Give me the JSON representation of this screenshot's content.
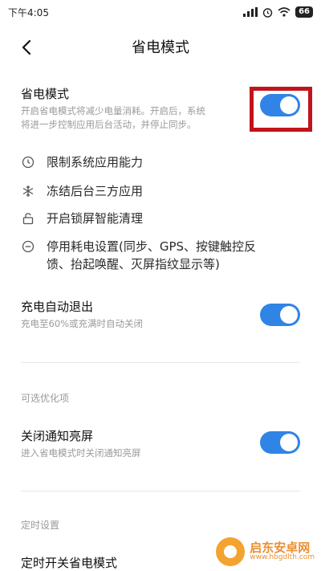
{
  "status_bar": {
    "time": "下午4:05",
    "signal": "..ll",
    "alarm": "⏰",
    "wifi": "wifi",
    "battery": "66"
  },
  "header": {
    "title": "省电模式"
  },
  "power_saving": {
    "title": "省电模式",
    "desc_line1": "开启省电模式将减少电量消耗。开启后，系统",
    "desc_line2": "将进一步控制应用后台活动，并停止同步。",
    "enabled": true
  },
  "features": [
    {
      "icon": "clock-icon",
      "text": "限制系统应用能力"
    },
    {
      "icon": "snowflake-icon",
      "text": "冻结后台三方应用"
    },
    {
      "icon": "lock-icon",
      "text": "开启锁屏智能清理"
    },
    {
      "icon": "minus-circle-icon",
      "text_line1": "停用耗电设置(同步、GPS、按键触控反",
      "text_line2": "馈、抬起唤醒、灭屏指纹显示等)"
    }
  ],
  "auto_exit": {
    "title": "充电自动退出",
    "desc": "充电至60%或充满时自动关闭",
    "enabled": true
  },
  "optional_section": {
    "label": "可选优化项"
  },
  "notify_screen": {
    "title": "关闭通知亮屏",
    "desc": "进入省电模式时关闭通知亮屏",
    "enabled": true
  },
  "schedule_section": {
    "label": "定时设置"
  },
  "schedule": {
    "title": "定时开关省电模式"
  },
  "watermark": {
    "name": "启东安卓网",
    "url": "www.hbgdlth.com"
  },
  "colors": {
    "accent": "#2f84e6",
    "highlight": "#c0141c"
  }
}
